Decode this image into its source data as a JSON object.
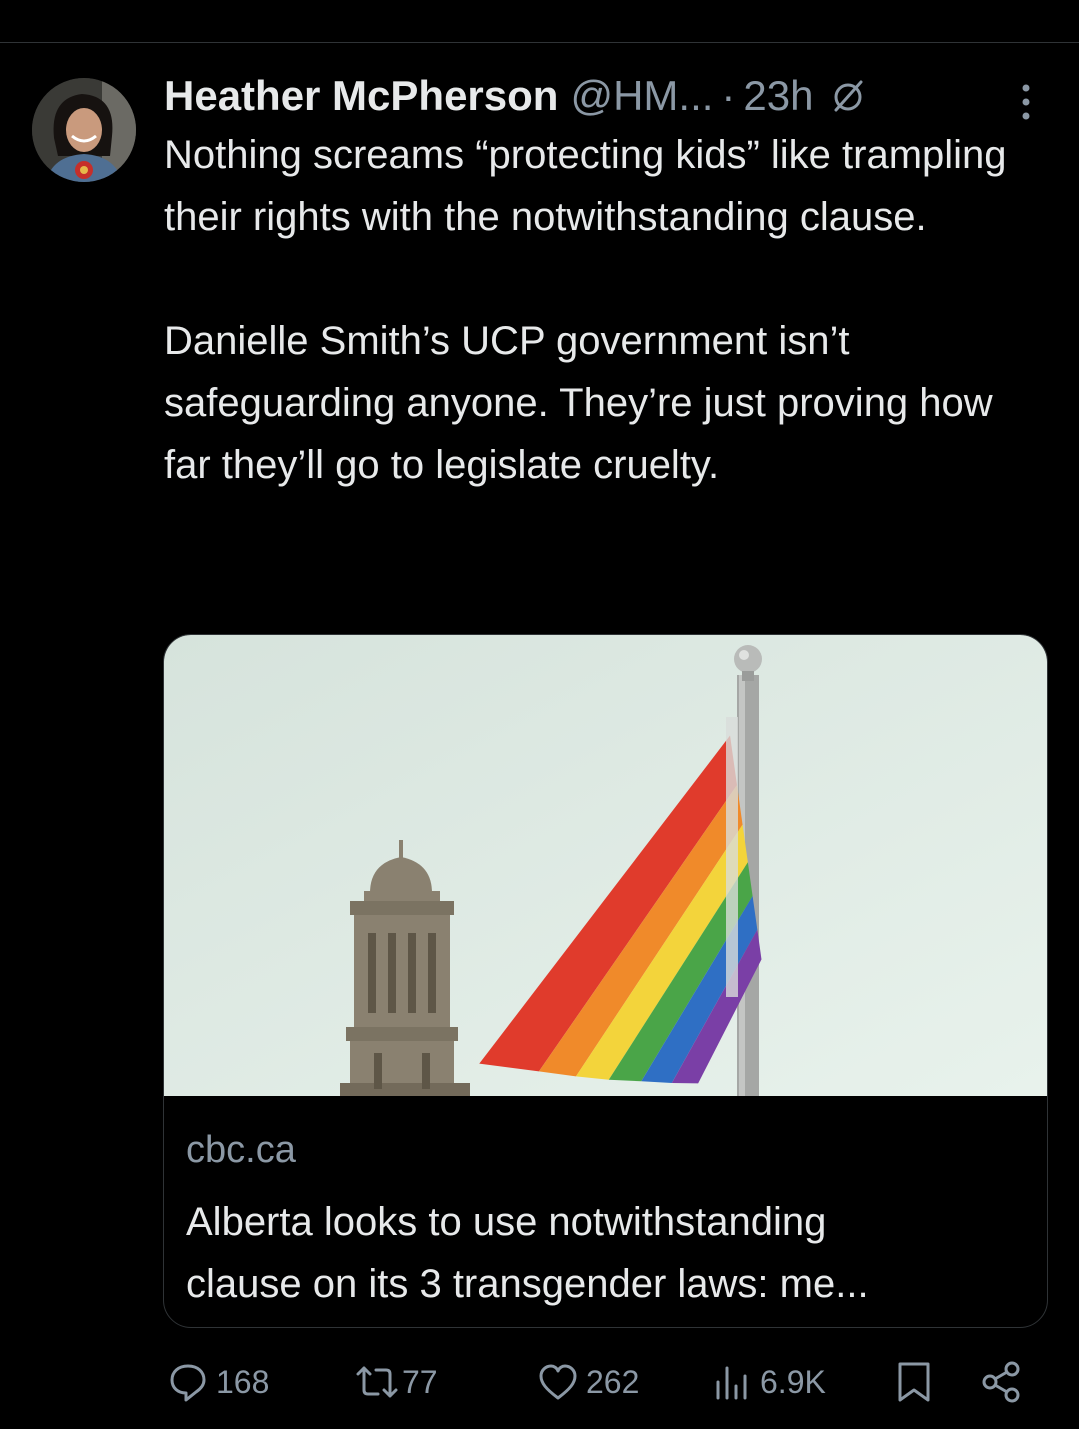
{
  "tweet": {
    "author_name": "Heather McPherson",
    "author_handle": "@HM...",
    "separator": "·",
    "timestamp": "23h",
    "paragraphs": [
      "Nothing screams “protecting kids” like trampling their rights with the notwithstanding clause.",
      "Danielle Smith’s UCP government isn’t safeguarding anyone. They’re just proving how far they’ll go to legislate cruelty."
    ]
  },
  "link_card": {
    "domain": "cbc.ca",
    "title_line1": "Alberta looks to use notwithstanding",
    "title_line2": "clause on its 3 transgender laws: me..."
  },
  "actions": {
    "replies": "168",
    "reposts": "77",
    "likes": "262",
    "views": "6.9K"
  },
  "icons": {
    "edited": "edited-icon",
    "more": "more-vertical-icon",
    "reply": "reply-icon",
    "repost": "repost-icon",
    "like": "heart-icon",
    "views": "views-icon",
    "bookmark": "bookmark-icon",
    "share": "share-icon"
  },
  "colors": {
    "background": "#000000",
    "primary_text": "#e7e9ea",
    "secondary_text": "#8b98a5",
    "border": "#2f3336"
  }
}
